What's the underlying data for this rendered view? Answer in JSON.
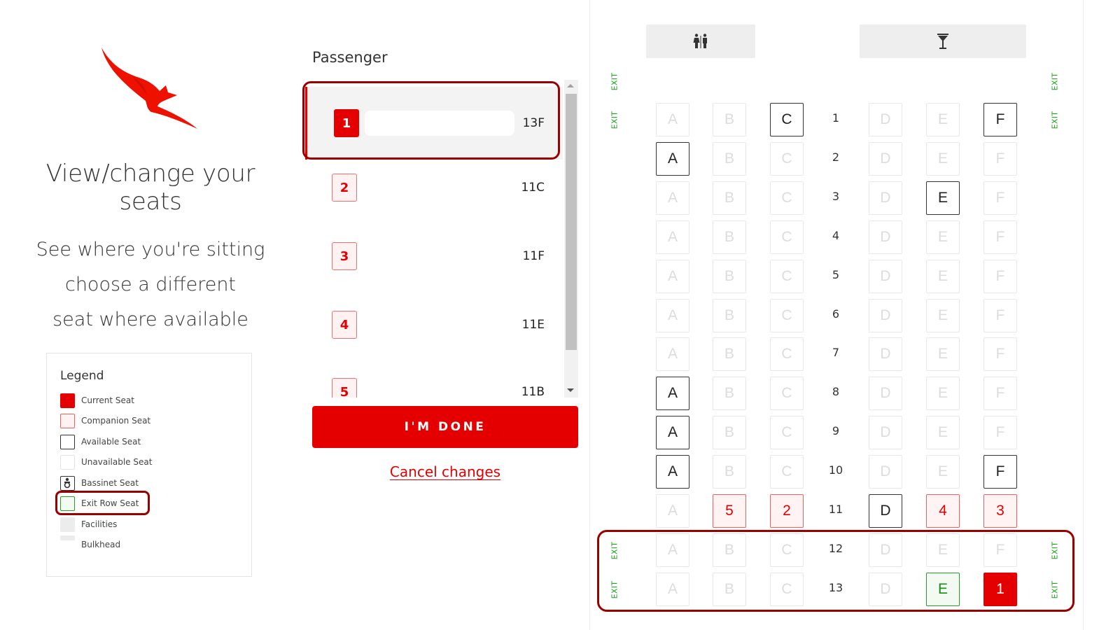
{
  "brand": {
    "logo": "kangaroo-logo",
    "accent_color": "#e40000"
  },
  "left_panel": {
    "title": "View/change your seats",
    "subtitle_lines": [
      "See where you're sitting",
      "choose a different",
      "seat where available"
    ]
  },
  "legend": {
    "title": "Legend",
    "items": [
      {
        "key": "current",
        "label": "Current Seat"
      },
      {
        "key": "companion",
        "label": "Companion Seat"
      },
      {
        "key": "available",
        "label": "Available Seat"
      },
      {
        "key": "unavailable",
        "label": "Unavailable Seat"
      },
      {
        "key": "bassinet",
        "label": "Bassinet Seat"
      },
      {
        "key": "exit",
        "label": "Exit Row Seat"
      },
      {
        "key": "facilities",
        "label": "Facilities"
      },
      {
        "key": "bulkhead",
        "label": "Bulkhead"
      }
    ]
  },
  "passengers": {
    "heading": "Passenger",
    "list": [
      {
        "number": "1",
        "name": "",
        "seat": "13F",
        "selected": true
      },
      {
        "number": "2",
        "name": "",
        "seat": "11C",
        "selected": false
      },
      {
        "number": "3",
        "name": "",
        "seat": "11F",
        "selected": false
      },
      {
        "number": "4",
        "name": "",
        "seat": "11E",
        "selected": false
      },
      {
        "number": "5",
        "name": "",
        "seat": "11B",
        "selected": false
      }
    ]
  },
  "actions": {
    "done_label": "I'M DONE",
    "cancel_label": "Cancel changes"
  },
  "seat_map": {
    "facilities": [
      {
        "type": "lavatory",
        "icon": "restroom-icon"
      },
      {
        "type": "galley",
        "icon": "cocktail-icon"
      }
    ],
    "exit_label": "EXIT",
    "columns_left": [
      "A",
      "B",
      "C"
    ],
    "columns_right": [
      "D",
      "E",
      "F"
    ],
    "rows": [
      {
        "row": "1",
        "exit": true,
        "seats": [
          "unavailable",
          "unavailable",
          "available",
          "unavailable",
          "unavailable",
          "available"
        ]
      },
      {
        "row": "2",
        "exit": false,
        "seats": [
          "available",
          "unavailable",
          "unavailable",
          "unavailable",
          "unavailable",
          "unavailable"
        ]
      },
      {
        "row": "3",
        "exit": false,
        "seats": [
          "unavailable",
          "unavailable",
          "unavailable",
          "unavailable",
          "available",
          "unavailable"
        ]
      },
      {
        "row": "4",
        "exit": false,
        "seats": [
          "unavailable",
          "unavailable",
          "unavailable",
          "unavailable",
          "unavailable",
          "unavailable"
        ]
      },
      {
        "row": "5",
        "exit": false,
        "seats": [
          "unavailable",
          "unavailable",
          "unavailable",
          "unavailable",
          "unavailable",
          "unavailable"
        ]
      },
      {
        "row": "6",
        "exit": false,
        "seats": [
          "unavailable",
          "unavailable",
          "unavailable",
          "unavailable",
          "unavailable",
          "unavailable"
        ]
      },
      {
        "row": "7",
        "exit": false,
        "seats": [
          "unavailable",
          "unavailable",
          "unavailable",
          "unavailable",
          "unavailable",
          "unavailable"
        ]
      },
      {
        "row": "8",
        "exit": false,
        "seats": [
          "available",
          "unavailable",
          "unavailable",
          "unavailable",
          "unavailable",
          "unavailable"
        ]
      },
      {
        "row": "9",
        "exit": false,
        "seats": [
          "available",
          "unavailable",
          "unavailable",
          "unavailable",
          "unavailable",
          "unavailable"
        ]
      },
      {
        "row": "10",
        "exit": false,
        "seats": [
          "available",
          "unavailable",
          "unavailable",
          "unavailable",
          "unavailable",
          "available"
        ]
      },
      {
        "row": "11",
        "exit": false,
        "seats": [
          "unavailable",
          "companion:5",
          "companion:2",
          "available",
          "companion:4",
          "companion:3"
        ]
      },
      {
        "row": "12",
        "exit": true,
        "seats": [
          "unavailable",
          "unavailable",
          "unavailable",
          "unavailable",
          "unavailable",
          "unavailable"
        ]
      },
      {
        "row": "13",
        "exit": true,
        "seats": [
          "unavailable",
          "unavailable",
          "unavailable",
          "unavailable",
          "exit",
          "current:1"
        ]
      }
    ]
  }
}
